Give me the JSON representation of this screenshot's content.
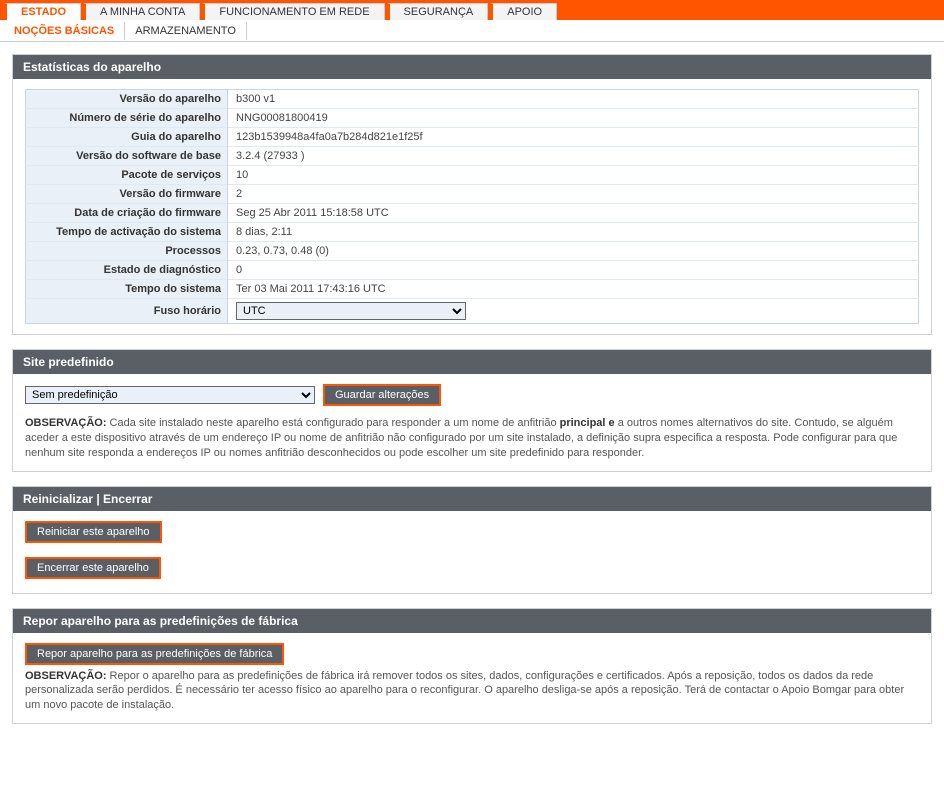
{
  "mainTabs": [
    {
      "label": "ESTADO",
      "active": true
    },
    {
      "label": "A MINHA CONTA",
      "active": false
    },
    {
      "label": "FUNCIONAMENTO EM REDE",
      "active": false
    },
    {
      "label": "SEGURANÇA",
      "active": false
    },
    {
      "label": "APOIO",
      "active": false
    }
  ],
  "subTabs": [
    {
      "label": "NOÇÕES BÁSICAS",
      "active": true
    },
    {
      "label": "ARMAZENAMENTO",
      "active": false
    }
  ],
  "stats": {
    "header": "Estatísticas do aparelho",
    "rows": [
      {
        "label": "Versão do aparelho",
        "value": "b300 v1"
      },
      {
        "label": "Número de série do aparelho",
        "value": "NNG00081800419"
      },
      {
        "label": "Guia do aparelho",
        "value": "123b1539948a4fa0a7b284d821e1f25f"
      },
      {
        "label": "Versão do software de base",
        "value": "3.2.4 (27933 )"
      },
      {
        "label": "Pacote de serviços",
        "value": "10"
      },
      {
        "label": "Versão do firmware",
        "value": "2"
      },
      {
        "label": "Data de criação do firmware",
        "value": "Seg 25 Abr 2011 15:18:58 UTC"
      },
      {
        "label": "Tempo de activação do sistema",
        "value": "8 dias, 2:11"
      },
      {
        "label": "Processos",
        "value": "0.23, 0.73, 0.48 (0)"
      },
      {
        "label": "Estado de diagnóstico",
        "value": "0"
      },
      {
        "label": "Tempo do sistema",
        "value": "Ter 03 Mai 2011 17:43:16 UTC"
      }
    ],
    "tzLabel": "Fuso horário",
    "tzValue": "UTC"
  },
  "defaultSite": {
    "header": "Site predefinido",
    "selectValue": "Sem predefinição",
    "saveButton": "Guardar alterações",
    "notePrefix": "OBSERVAÇÃO:",
    "noteTextA": " Cada site instalado neste aparelho está configurado para responder a um nome de anfitrião ",
    "noteBold": "principal e",
    "noteTextB": " a outros nomes alternativos do site. Contudo, se alguém aceder a este dispositivo através de um endereço IP ou nome de anfitrião não configurado por um site instalado, a definição supra especifica a resposta. Pode configurar para que nenhum site responda a endereços IP ou nomes anfitrião desconhecidos ou pode escolher um site predefinido para responder."
  },
  "restart": {
    "header": "Reinicializar | Encerrar",
    "restartBtn": "Reiniciar este aparelho",
    "shutdownBtn": "Encerrar este aparelho"
  },
  "reset": {
    "header": "Repor aparelho para as predefinições de fábrica",
    "resetBtn": "Repor aparelho para as predefinições de fábrica",
    "notePrefix": "OBSERVAÇÃO:",
    "noteText": " Repor o aparelho para as predefinições de fábrica irá remover todos os sites, dados, configurações e certificados. Após a reposição, todos os dados da rede personalizada serão perdidos. É necessário ter acesso físico ao aparelho para o reconfigurar. O aparelho desliga-se após a reposição. Terá de contactar o Apoio Bomgar para obter um novo pacote de instalação."
  }
}
